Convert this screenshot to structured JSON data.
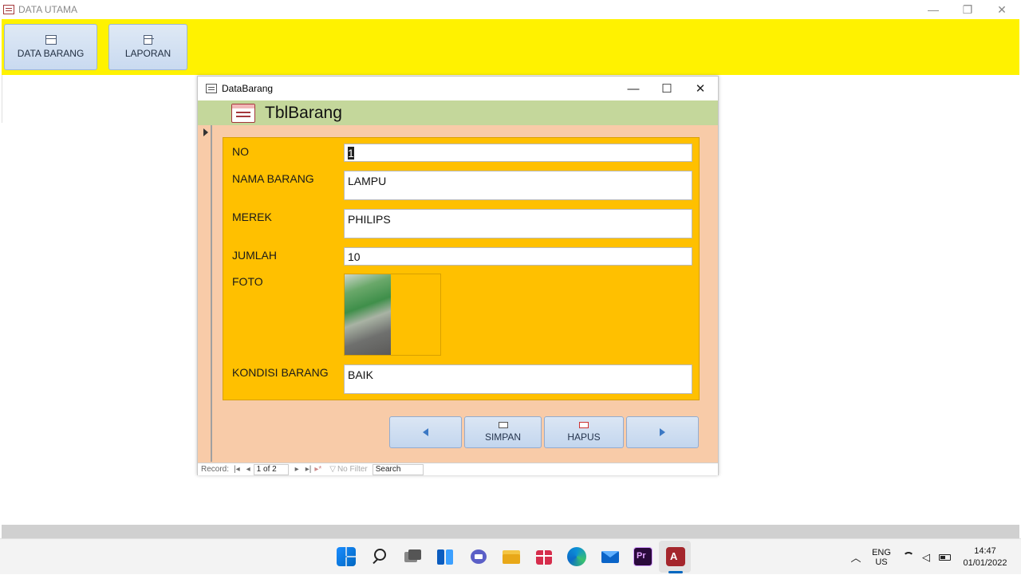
{
  "window": {
    "title": "DATA UTAMA",
    "minimize_glyph": "—",
    "restore_glyph": "❐",
    "close_glyph": "✕"
  },
  "ribbon": {
    "data_barang_label": "DATA BARANG",
    "laporan_label": "LAPORAN"
  },
  "form": {
    "title": "DataBarang",
    "minimize_glyph": "—",
    "maximize_glyph": "☐",
    "close_glyph": "✕",
    "header_title": "TblBarang",
    "fields": {
      "no_label": "NO",
      "no_value": "1",
      "nama_label": "NAMA BARANG",
      "nama_value": "LAMPU",
      "merek_label": "MEREK",
      "merek_value": "PHILIPS",
      "jumlah_label": "JUMLAH",
      "jumlah_value": "10",
      "foto_label": "FOTO",
      "kondisi_label": "KONDISI BARANG",
      "kondisi_value": "BAIK"
    },
    "buttons": {
      "simpan_label": "SIMPAN",
      "hapus_label": "HAPUS"
    },
    "record_nav": {
      "label": "Record:",
      "position": "1 of 2",
      "filter": "No Filter",
      "search": "Search",
      "first_glyph": "|◂",
      "prev_glyph": "◂",
      "next_glyph": "▸",
      "last_glyph": "▸|",
      "new_glyph": "▸*"
    }
  },
  "taskbar": {
    "apps": [
      "start-icon",
      "search-icon",
      "task-view-icon",
      "widgets-icon",
      "teams-chat-icon",
      "file-explorer-icon",
      "gift-icon",
      "edge-icon",
      "mail-icon",
      "premiere-icon",
      "access-icon"
    ],
    "lang_line1": "ENG",
    "lang_line2": "US",
    "time": "14:47",
    "date": "01/01/2022",
    "chevron_glyph": "︿"
  }
}
